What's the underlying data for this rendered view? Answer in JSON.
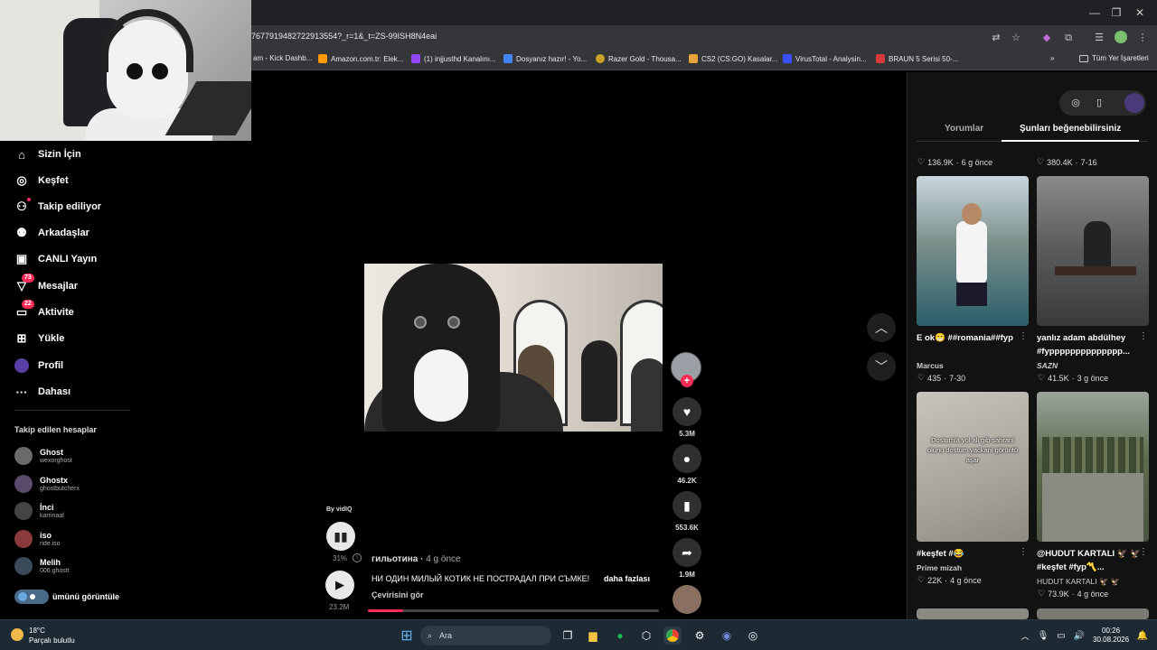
{
  "browser": {
    "url": "7677919482722913554?_r=1&_t=ZS-99ISH8N4eai",
    "bookmarks": [
      "am - Kick Dashb...",
      "Amazon.com.tr: Elek...",
      "(1) injjusthd Kanalını...",
      "Dosyanız hazır! - Yo...",
      "Razer Gold - Thousa...",
      "CS2 (CS:GO) Kasalar...",
      "VirusTotal - Analysin...",
      "BRAUN 5 Serisi 50-..."
    ],
    "all_bookmarks": "Tüm Yer İşaretleri",
    "bookmark_colors": [
      "#52b043",
      "#ff9900",
      "#9146ff",
      "#4285f4",
      "#c9a227",
      "#e8a33b",
      "#3a50ff",
      "#d63a3a"
    ]
  },
  "nav": {
    "items": [
      {
        "label": "Sizin İçin",
        "icon": "home-icon"
      },
      {
        "label": "Keşfet",
        "icon": "compass-icon"
      },
      {
        "label": "Takip ediliyor",
        "icon": "following-icon"
      },
      {
        "label": "Arkadaşlar",
        "icon": "friends-icon"
      },
      {
        "label": "CANLI Yayın",
        "icon": "live-icon"
      },
      {
        "label": "Mesajlar",
        "icon": "message-icon",
        "badge": "73"
      },
      {
        "label": "Aktivite",
        "icon": "activity-icon",
        "badge": "22"
      },
      {
        "label": "Yükle",
        "icon": "upload-icon"
      },
      {
        "label": "Profil",
        "icon": "profile-avatar"
      },
      {
        "label": "Dahası",
        "icon": "more-icon"
      }
    ],
    "followed_title": "Takip edilen hesaplar",
    "accounts": [
      {
        "name": "Ghost",
        "handle": "wexorghost"
      },
      {
        "name": "Ghostx",
        "handle": "ghostbutcherx"
      },
      {
        "name": "İnci",
        "handle": "karrinaal"
      },
      {
        "name": "iso",
        "handle": "ride.iso"
      },
      {
        "name": "Melih",
        "handle": "006.ghostt"
      }
    ],
    "bottom_label": "ümünü görüntüle"
  },
  "video": {
    "vidiq_label": "By vidIQ",
    "vidiq_percent": "31%",
    "views": "23.2M",
    "author": "гильотина",
    "time": "4 g önce",
    "caption": "НИ ОДИН МИЛЫЙ КОТИК НЕ ПОСТРАДАЛ ПРИ СЪМКЕ!",
    "more_label": "daha fazlası",
    "translate_label": "Çevirisini gör",
    "progress": 0.12,
    "likes": "5.3M",
    "comments": "46.2K",
    "saves": "553.6K",
    "shares": "1.9M",
    "accent": "#fe2c55"
  },
  "right_panel": {
    "tab_comments": "Yorumlar",
    "tab_suggested": "Şunları beğenebilirsiniz",
    "top_meta": [
      {
        "likes": "136.9K",
        "time": "6 g önce"
      },
      {
        "likes": "380.4K",
        "time": "7-16"
      }
    ],
    "cards": [
      {
        "title": "E ok😁 ##romania##fyp",
        "author": "Marcus",
        "likes": "435",
        "time": "7-30"
      },
      {
        "title": "yanlız adam abdülhey #fypppppppppppppp...",
        "author": "SAZN",
        "likes": "41.5K",
        "time": "3 g önce"
      },
      {
        "title": "#keşfet #😂",
        "author": "Prime mizah",
        "likes": "22K",
        "time": "4 g önce",
        "overlay": "Dostumla yol ali gib sahrani olunu dostum yackani görüntü aşar"
      },
      {
        "title": "@HUDUT KARTALI 🦅 🦅 #keşfet #fyp〽️...",
        "author": "HUDUT KARTALI 🦅 🦅",
        "likes": "73.9K",
        "time": "4 g önce"
      }
    ]
  },
  "taskbar": {
    "temp": "18°C",
    "weather": "Parçalı bulutlu",
    "search": "Ara",
    "time": "00:26",
    "date": "30.08.2026"
  }
}
